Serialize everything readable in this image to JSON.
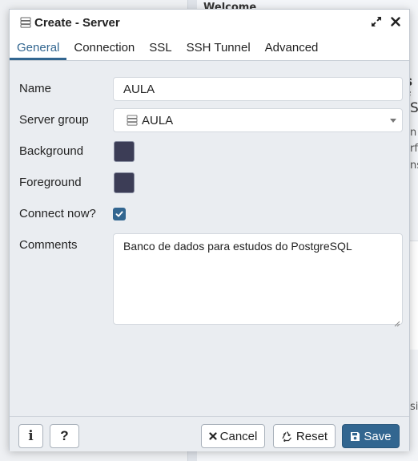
{
  "background": {
    "tab_title": "Welcome",
    "fragments": [
      "s f",
      "S",
      "n",
      "rfa",
      "ns",
      "sit"
    ]
  },
  "dialog": {
    "title": "Create - Server",
    "title_icon": "server-icon",
    "expand_icon": "expand-icon",
    "close_icon": "close-icon"
  },
  "tabs": [
    {
      "label": "General",
      "active": true
    },
    {
      "label": "Connection",
      "active": false
    },
    {
      "label": "SSL",
      "active": false
    },
    {
      "label": "SSH Tunnel",
      "active": false
    },
    {
      "label": "Advanced",
      "active": false
    }
  ],
  "form": {
    "name": {
      "label": "Name",
      "value": "AULA"
    },
    "server_group": {
      "label": "Server group",
      "value": "AULA",
      "icon": "server-group-icon"
    },
    "background": {
      "label": "Background",
      "color": "#3c3d56"
    },
    "foreground": {
      "label": "Foreground",
      "color": "#3c3d56"
    },
    "connect_now": {
      "label": "Connect now?",
      "checked": true
    },
    "comments": {
      "label": "Comments",
      "value": "Banco de dados para estudos do PostgreSQL"
    }
  },
  "footer": {
    "info_label": "i",
    "help_label": "?",
    "cancel_label": "Cancel",
    "reset_label": "Reset",
    "save_label": "Save"
  },
  "colors": {
    "accent": "#326690",
    "swatch": "#3c3d56",
    "dialog_bg": "#eaedf1"
  }
}
